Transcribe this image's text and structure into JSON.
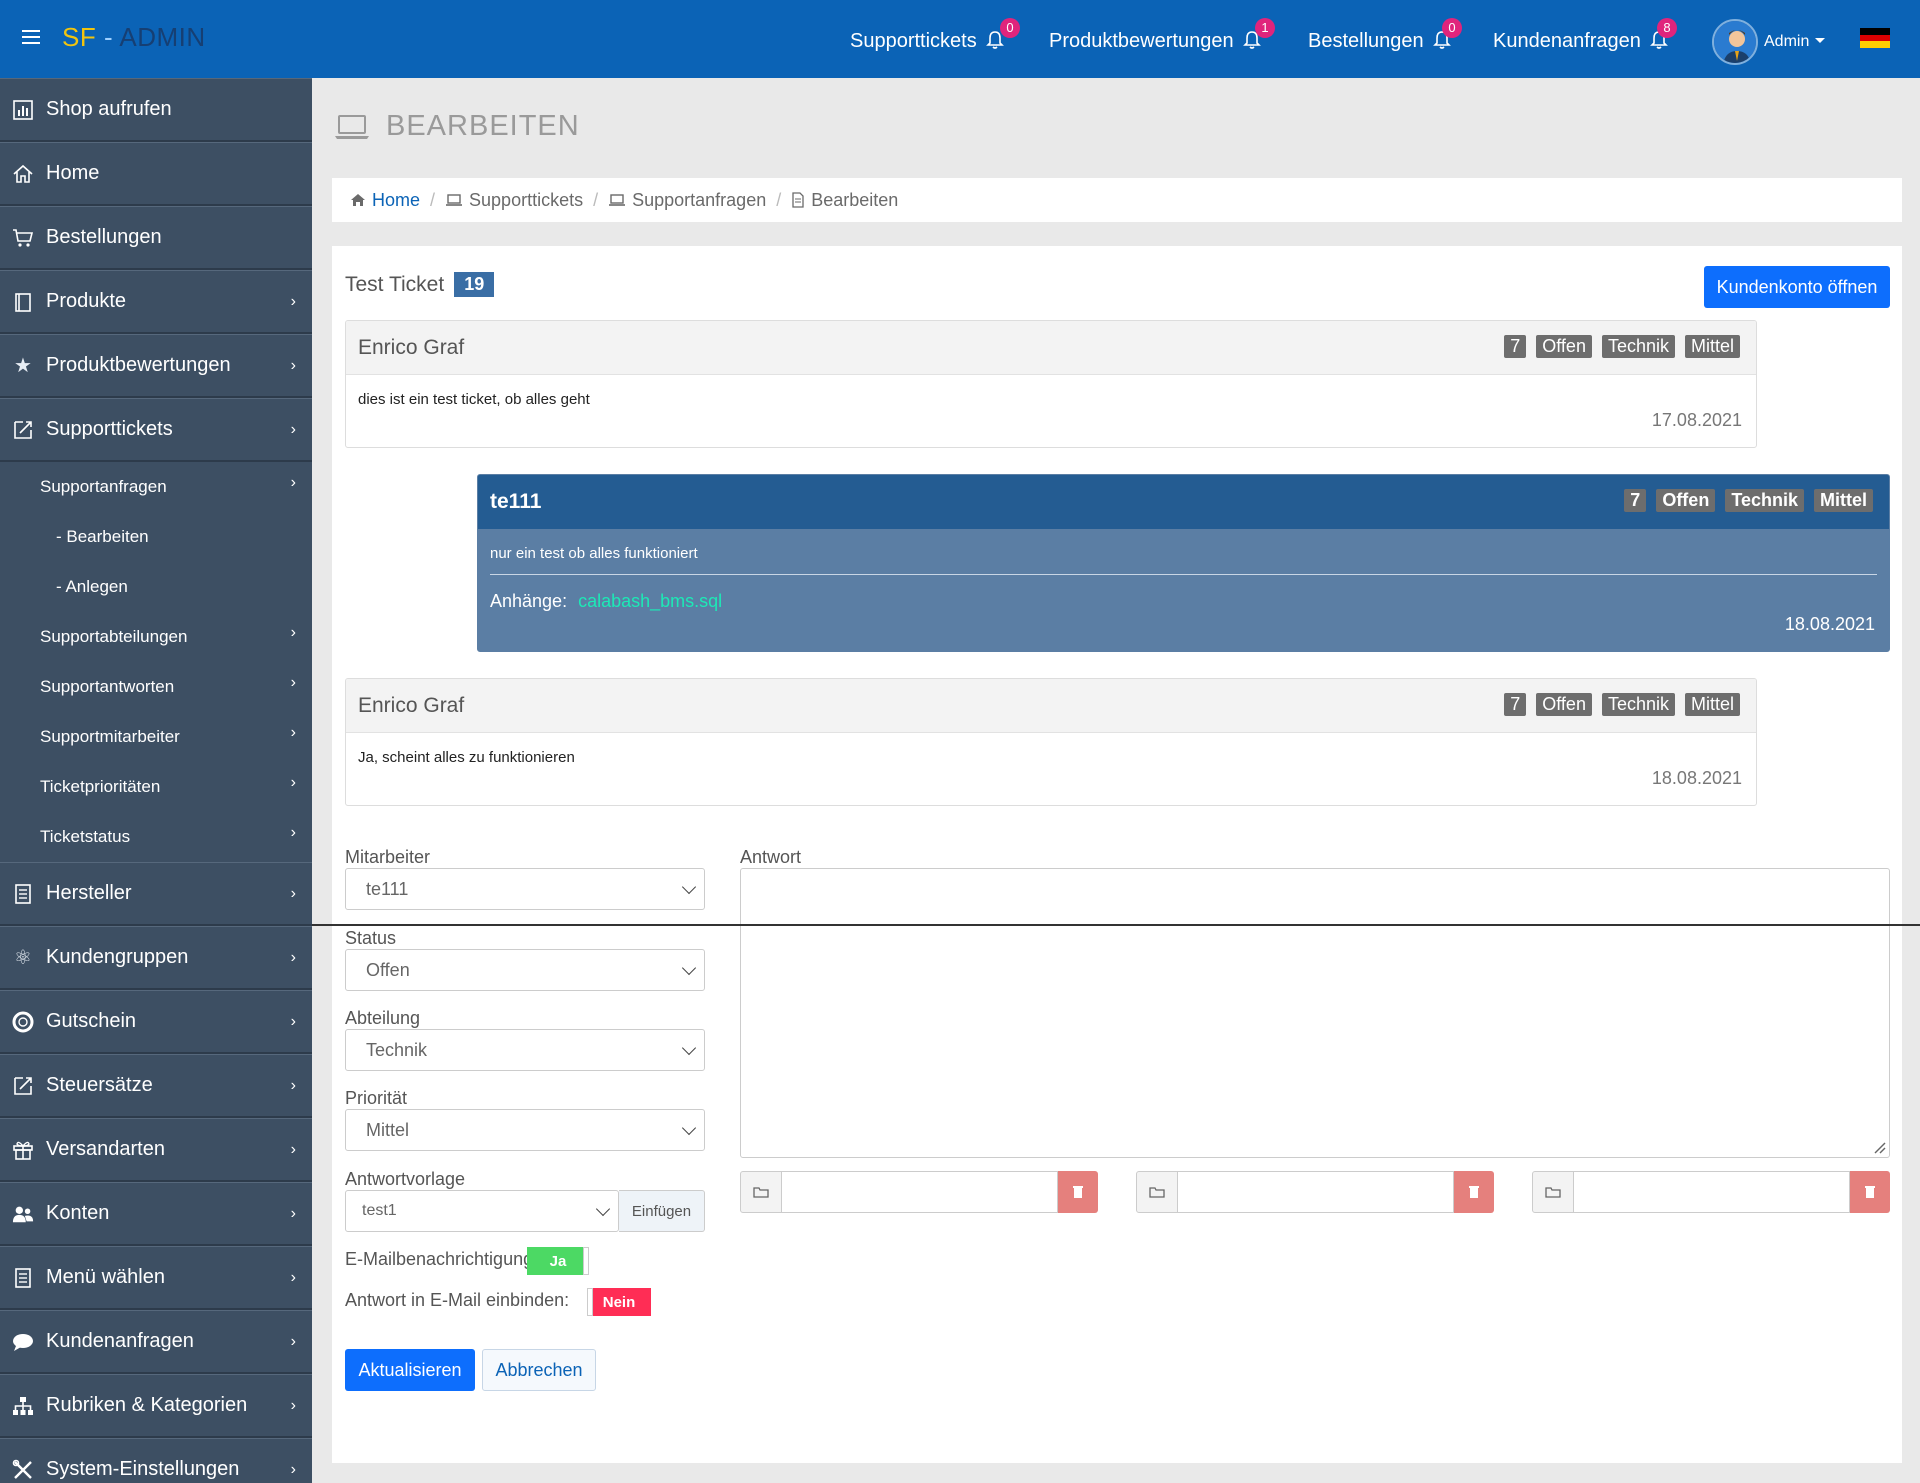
{
  "header": {
    "brand_sf": "SF",
    "brand_dash": " - ",
    "brand_admin": "ADMIN",
    "nav": [
      {
        "label": "Supporttickets",
        "count": "0"
      },
      {
        "label": "Produktbewertungen",
        "count": "1"
      },
      {
        "label": "Bestellungen",
        "count": "0"
      },
      {
        "label": "Kundenanfragen",
        "count": "8"
      }
    ],
    "user_label": "Admin"
  },
  "sidebar": {
    "items": [
      {
        "label": "Shop aufrufen",
        "icon": "bar-chart-icon"
      },
      {
        "label": "Home",
        "icon": "home-icon"
      },
      {
        "label": "Bestellungen",
        "icon": "cart-icon"
      },
      {
        "label": "Produkte",
        "icon": "book-icon"
      },
      {
        "label": "Produktbewertungen",
        "icon": "star-icon"
      },
      {
        "label": "Supporttickets",
        "icon": "ticket-icon"
      }
    ],
    "support_sub": [
      {
        "label": "Supportanfragen"
      }
    ],
    "support_subsub": [
      {
        "label": "- Bearbeiten"
      },
      {
        "label": "- Anlegen"
      }
    ],
    "support_sub2": [
      {
        "label": "Supportabteilungen"
      },
      {
        "label": "Supportantworten"
      },
      {
        "label": "Supportmitarbeiter"
      },
      {
        "label": "Ticketprioritäten"
      },
      {
        "label": "Ticketstatus"
      }
    ],
    "items2": [
      {
        "label": "Hersteller",
        "icon": "list-icon"
      },
      {
        "label": "Kundengruppen",
        "icon": "atom-icon"
      },
      {
        "label": "Gutschein",
        "icon": "lifebuoy-icon"
      },
      {
        "label": "Steuersätze",
        "icon": "ticket-icon"
      },
      {
        "label": "Versandarten",
        "icon": "gift-icon"
      },
      {
        "label": "Konten",
        "icon": "users-icon"
      },
      {
        "label": "Menü wählen",
        "icon": "menu-list-icon"
      },
      {
        "label": "Kundenanfragen",
        "icon": "chat-icon"
      },
      {
        "label": "Rubriken & Kategorien",
        "icon": "sitemap-icon"
      },
      {
        "label": "System-Einstellungen",
        "icon": "tools-icon"
      }
    ]
  },
  "page": {
    "title": "BEARBEITEN",
    "breadcrumb": [
      "Home",
      "Supporttickets",
      "Supportanfragen",
      "Bearbeiten"
    ]
  },
  "ticket": {
    "title": "Test Ticket",
    "number": "19",
    "open_account_button": "Kundenkonto öffnen",
    "messages": [
      {
        "author": "Enrico Graf",
        "tags": [
          "7",
          "Offen",
          "Technik",
          "Mittel"
        ],
        "text": "dies ist ein test ticket, ob alles geht",
        "date": "17.08.2021"
      },
      {
        "author": "te111",
        "tags": [
          "7",
          "Offen",
          "Technik",
          "Mittel"
        ],
        "text": "nur ein test ob alles funktioniert",
        "attachments_label": "Anhänge:",
        "attachment": "calabash_bms.sql",
        "date": "18.08.2021"
      },
      {
        "author": "Enrico Graf",
        "tags": [
          "7",
          "Offen",
          "Technik",
          "Mittel"
        ],
        "text": "Ja, scheint alles zu funktionieren",
        "date": "18.08.2021"
      }
    ]
  },
  "form": {
    "employee_label": "Mitarbeiter",
    "employee_value": "te111",
    "status_label": "Status",
    "status_value": "Offen",
    "department_label": "Abteilung",
    "department_value": "Technik",
    "priority_label": "Priorität",
    "priority_value": "Mittel",
    "template_label": "Antwortvorlage",
    "template_value": "test1",
    "insert_button": "Einfügen",
    "answer_label": "Antwort",
    "email_notify_label": "E-Mailbenachrichtigung:",
    "email_notify_value": "Ja",
    "include_answer_label": "Antwort in E-Mail einbinden:",
    "include_answer_value": "Nein",
    "update_button": "Aktualisieren",
    "cancel_button": "Abbrechen"
  },
  "colors": {
    "header_bg": "#0b63b6",
    "sidebar_bg": "#3d4f63",
    "primary": "#0d6efd",
    "badge": "#e0247c",
    "staff_head": "#245c92",
    "staff_body": "#5b7ea4",
    "toggle_on": "#4cd964",
    "toggle_off": "#ff2d55"
  }
}
